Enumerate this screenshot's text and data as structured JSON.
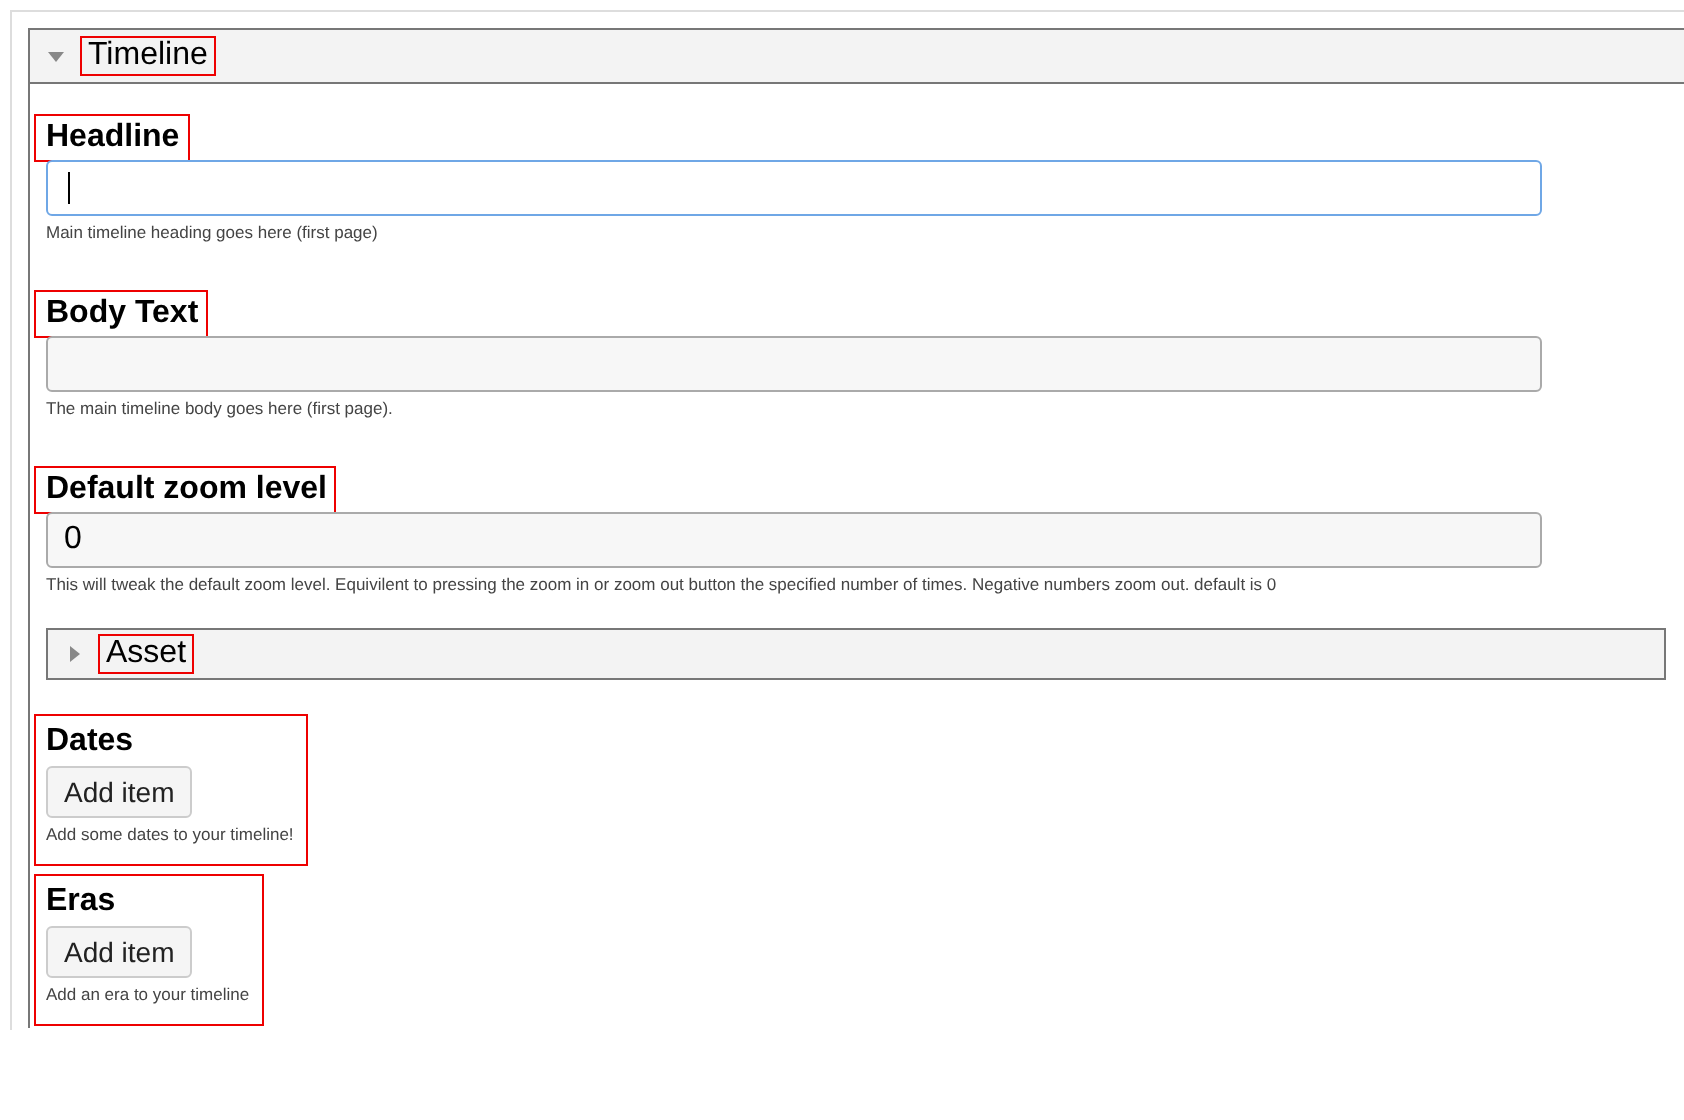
{
  "panel": {
    "title": "Timeline",
    "expanded": true,
    "highlighted": true
  },
  "fields": [
    {
      "label": "Headline",
      "focused": true,
      "highlighted": true,
      "help": "Main timeline heading goes here (first page)"
    },
    {
      "label": "Body Text",
      "focused": false,
      "highlighted": true,
      "help": "The main timeline body goes here (first page)."
    },
    {
      "label": "Default zoom level",
      "value": "0",
      "focused": false,
      "highlighted": true,
      "help": "This will tweak the default zoom level. Equivilent to pressing the zoom in or zoom out button the specified number of times. Negative numbers zoom out. default is 0"
    }
  ],
  "subpanel": {
    "title": "Asset",
    "expanded": false,
    "highlighted": true
  },
  "lists": [
    {
      "label": "Dates",
      "button": "Add item",
      "help": "Add some dates to your timeline!",
      "highlighted": true
    },
    {
      "label": "Eras",
      "button": "Add item",
      "help": "Add an era to your timeline",
      "highlighted": true
    }
  ]
}
